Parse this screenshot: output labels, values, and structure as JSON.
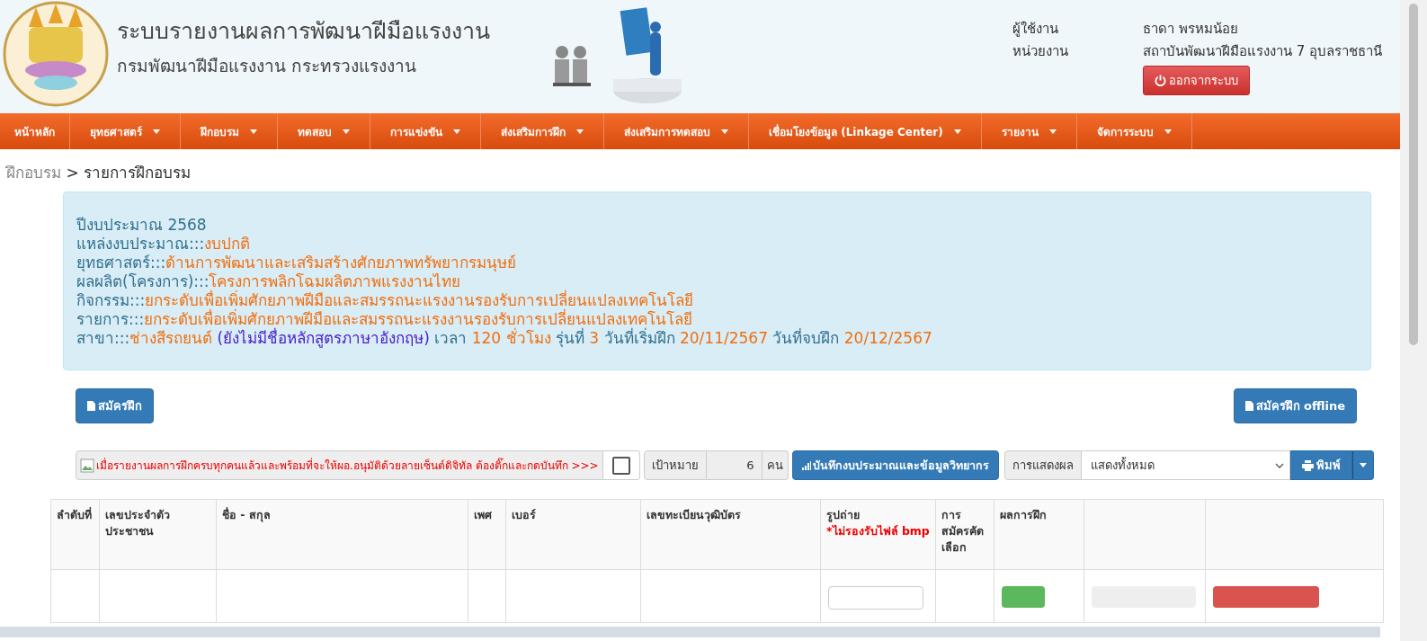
{
  "header": {
    "title": "ระบบรายงานผลการพัฒนาฝีมือแรงงาน",
    "subtitle": "กรมพัฒนาฝีมือแรงงาน กระทรวงแรงงาน",
    "user_info": [
      {
        "label": "ผู้ใช้งาน",
        "value": "ธาดา พรหมน้อย"
      },
      {
        "label": "หน่วยงาน",
        "value": "สถาบันพัฒนาฝีมือแรงงาน 7 อุบลราชธานี"
      }
    ],
    "logout_button": "ออกจากระบบ"
  },
  "nav": [
    {
      "label": "หน้าหลัก",
      "dropdown": false
    },
    {
      "label": "ยุทธศาสตร์",
      "dropdown": true
    },
    {
      "label": "ฝึกอบรม",
      "dropdown": true
    },
    {
      "label": "ทดสอบ",
      "dropdown": true
    },
    {
      "label": "การแข่งขัน",
      "dropdown": true
    },
    {
      "label": "ส่งเสริมการฝึก",
      "dropdown": true
    },
    {
      "label": "ส่งเสริมการทดสอบ",
      "dropdown": true
    },
    {
      "label": "เชื่อมโยงข้อมูล (Linkage Center)",
      "dropdown": true
    },
    {
      "label": "รายงาน",
      "dropdown": true
    },
    {
      "label": "จัดการระบบ",
      "dropdown": true
    }
  ],
  "breadcrumb": {
    "parent": "ฝึกอบรม",
    "separator": ">",
    "current": "รายการฝึกอบรม"
  },
  "info": [
    [
      {
        "kind": "label",
        "text": "ปีงบประมาณ 2568"
      }
    ],
    [
      {
        "kind": "label",
        "text": "แหล่งงบประมาณ:::"
      },
      {
        "kind": "value",
        "text": "งบปกติ"
      }
    ],
    [
      {
        "kind": "label",
        "text": "ยุทธศาสตร์:::"
      },
      {
        "kind": "value",
        "text": "ด้านการพัฒนาและเสริมสร้างศักยภาพทรัพยากรมนุษย์"
      }
    ],
    [
      {
        "kind": "label",
        "text": "ผลผลิต(โครงการ):::"
      },
      {
        "kind": "value",
        "text": "โครงการพลิกโฉมผลิตภาพแรงงานไทย"
      }
    ],
    [
      {
        "kind": "label",
        "text": "กิจกรรม:::"
      },
      {
        "kind": "value",
        "text": "ยกระดับเพื่อเพิ่มศักยภาพฝีมือและสมรรถนะแรงงานรองรับการเปลี่ยนแปลงเทคโนโลยี"
      }
    ],
    [
      {
        "kind": "label",
        "text": "รายการ:::"
      },
      {
        "kind": "value",
        "text": "ยกระดับเพื่อเพิ่มศักยภาพฝีมือและสมรรถนะแรงงานรองรับการเปลี่ยนแปลงเทคโนโลยี"
      }
    ],
    [
      {
        "kind": "label",
        "text": "สาขา:::"
      },
      {
        "kind": "value",
        "text": "ช่างสีรถยนต์"
      },
      {
        "kind": "note",
        "text": "(ยังไม่มีชื่อหลักสูตรภาษาอังกฤษ)"
      },
      {
        "kind": "label",
        "text": "เวลา"
      },
      {
        "kind": "value",
        "text": "120 ชั่วโมง"
      },
      {
        "kind": "label",
        "text": "รุ่นที่"
      },
      {
        "kind": "value",
        "text": "3"
      },
      {
        "kind": "label",
        "text": "วันที่เริ่มฝึก"
      },
      {
        "kind": "value",
        "text": "20/11/2567"
      },
      {
        "kind": "label",
        "text": "วันที่จบฝึก"
      },
      {
        "kind": "value",
        "text": "20/12/2567"
      }
    ]
  ],
  "apply_button": "สมัครฝึก",
  "apply_offline_button": "สมัครฝึก offline",
  "toolbar": {
    "approval_note": "เมื่อรายงานผลการฝึกครบทุกคนแล้วและพร้อมที่จะให้ผอ.อนุมัติด้วยลายเซ็นต์ดิจิทัล ต้องติ๊กและกดบันทึก >>>",
    "approval_checked": false,
    "target_label": "เป้าหมาย",
    "target_value": "6",
    "target_unit": "คน",
    "save_button": "บันทึกงบประมาณและข้อมูลวิทยากร",
    "display_label": "การแสดงผล",
    "display_value": "แสดงทั้งหมด",
    "print_button": "พิมพ์"
  },
  "table": {
    "columns": [
      {
        "label": "ลำดับที่"
      },
      {
        "label": "เลขประจำตัวประชาชน"
      },
      {
        "label": "ชื่อ - สกุล"
      },
      {
        "label": "เพศ"
      },
      {
        "label": "เบอร์"
      },
      {
        "label": "เลขทะเบียนวุฒิบัตร"
      },
      {
        "label": "รูปถ่าย",
        "note": "*ไม่รองรับไฟล์ bmp"
      },
      {
        "label": "การสมัครคัดเลือก"
      },
      {
        "label": "ผลการฝึก"
      },
      {},
      {}
    ],
    "rows": [
      {
        "cells": [
          {
            "kind": "empty"
          },
          {
            "kind": "empty"
          },
          {
            "kind": "empty"
          },
          {
            "kind": "empty"
          },
          {
            "kind": "empty"
          },
          {
            "kind": "empty"
          },
          {
            "kind": "upload"
          },
          {
            "kind": "empty"
          },
          {
            "kind": "success"
          },
          {
            "kind": "muted"
          },
          {
            "kind": "danger"
          }
        ]
      }
    ]
  }
}
